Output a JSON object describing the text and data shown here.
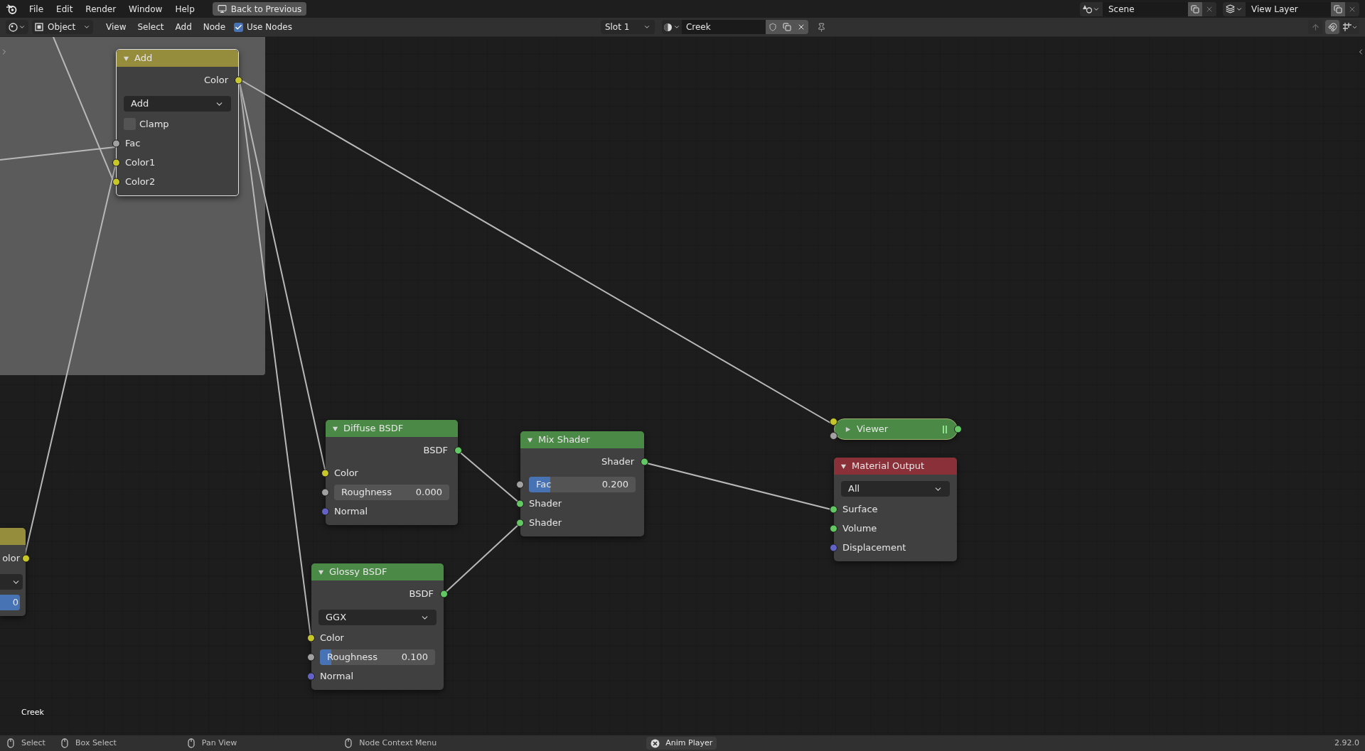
{
  "menu": [
    "File",
    "Edit",
    "Render",
    "Window",
    "Help"
  ],
  "back_button": "Back to Previous",
  "scene": "Scene",
  "view_layer": "View Layer",
  "header": {
    "mode": "Object",
    "menus": [
      "View",
      "Select",
      "Add",
      "Node"
    ],
    "use_nodes": {
      "label": "Use Nodes",
      "checked": true
    },
    "slot": "Slot 1",
    "material": "Creek"
  },
  "nodes": [
    {
      "kind": "node",
      "title": "Add",
      "color": "#958c3c",
      "rows": [
        {
          "kind": "output",
          "label": "Color",
          "color": "#c7c729"
        },
        {
          "kind": "dropdown",
          "label": "Add"
        },
        {
          "kind": "checkbox",
          "label": "Clamp",
          "checked": false
        },
        {
          "kind": "input",
          "label": "Fac",
          "color": "#a1a1a1"
        },
        {
          "kind": "input",
          "label": "Color1",
          "color": "#c7c729"
        },
        {
          "kind": "input",
          "label": "Color2",
          "color": "#c7c729"
        }
      ]
    },
    {
      "kind": "partial",
      "color": "#958c3c",
      "rows": [
        {
          "kind": "output",
          "label": "olor",
          "color": "#c7c729"
        },
        {
          "kind": "dropdown"
        },
        {
          "kind": "slider",
          "value": "0",
          "level": 1
        }
      ]
    },
    {
      "kind": "node",
      "title": "Diffuse BSDF",
      "color": "#4a8a46",
      "rows": [
        {
          "kind": "output",
          "label": "BSDF",
          "color": "#63c763"
        },
        {
          "kind": "input",
          "label": "Color",
          "color": "#c7c729"
        },
        {
          "kind": "slider",
          "label": "Roughness",
          "value": "0.000",
          "color": "#a1a1a1"
        },
        {
          "kind": "input",
          "label": "Normal",
          "color": "#6363c7"
        }
      ]
    },
    {
      "kind": "node",
      "title": "Mix Shader",
      "color": "#4a8a46",
      "rows": [
        {
          "kind": "output",
          "label": "Shader",
          "color": "#63c763"
        },
        {
          "kind": "slider",
          "label": "Fac",
          "value": "0.200",
          "level": 0.2,
          "color": "#a1a1a1"
        },
        {
          "kind": "input",
          "label": "Shader",
          "color": "#63c763"
        },
        {
          "kind": "input",
          "label": "Shader",
          "color": "#63c763"
        }
      ]
    },
    {
      "kind": "node",
      "title": "Glossy BSDF",
      "color": "#4a8a46",
      "rows": [
        {
          "kind": "output",
          "label": "BSDF",
          "color": "#63c763"
        },
        {
          "kind": "dropdown",
          "label": "GGX"
        },
        {
          "kind": "input",
          "label": "Color",
          "color": "#c7c729"
        },
        {
          "kind": "slider",
          "label": "Roughness",
          "value": "0.100",
          "level": 0.1,
          "color": "#a1a1a1"
        },
        {
          "kind": "input",
          "label": "Normal",
          "color": "#6363c7"
        }
      ]
    },
    {
      "kind": "collapsed",
      "title": "Viewer",
      "color": "#4a8a46"
    },
    {
      "kind": "node",
      "title": "Material Output",
      "color": "#8a3038",
      "rows": [
        {
          "kind": "dropdown",
          "label": "All"
        },
        {
          "kind": "input",
          "label": "Surface",
          "color": "#63c763"
        },
        {
          "kind": "input",
          "label": "Volume",
          "color": "#63c763"
        },
        {
          "kind": "input",
          "label": "Displacement",
          "color": "#6363c7"
        }
      ]
    }
  ],
  "material_label": "Creek",
  "status": [
    "Select",
    "Box Select",
    "Pan View",
    "Node Context Menu"
  ],
  "anim_player": "Anim Player",
  "version": "2.92.0"
}
